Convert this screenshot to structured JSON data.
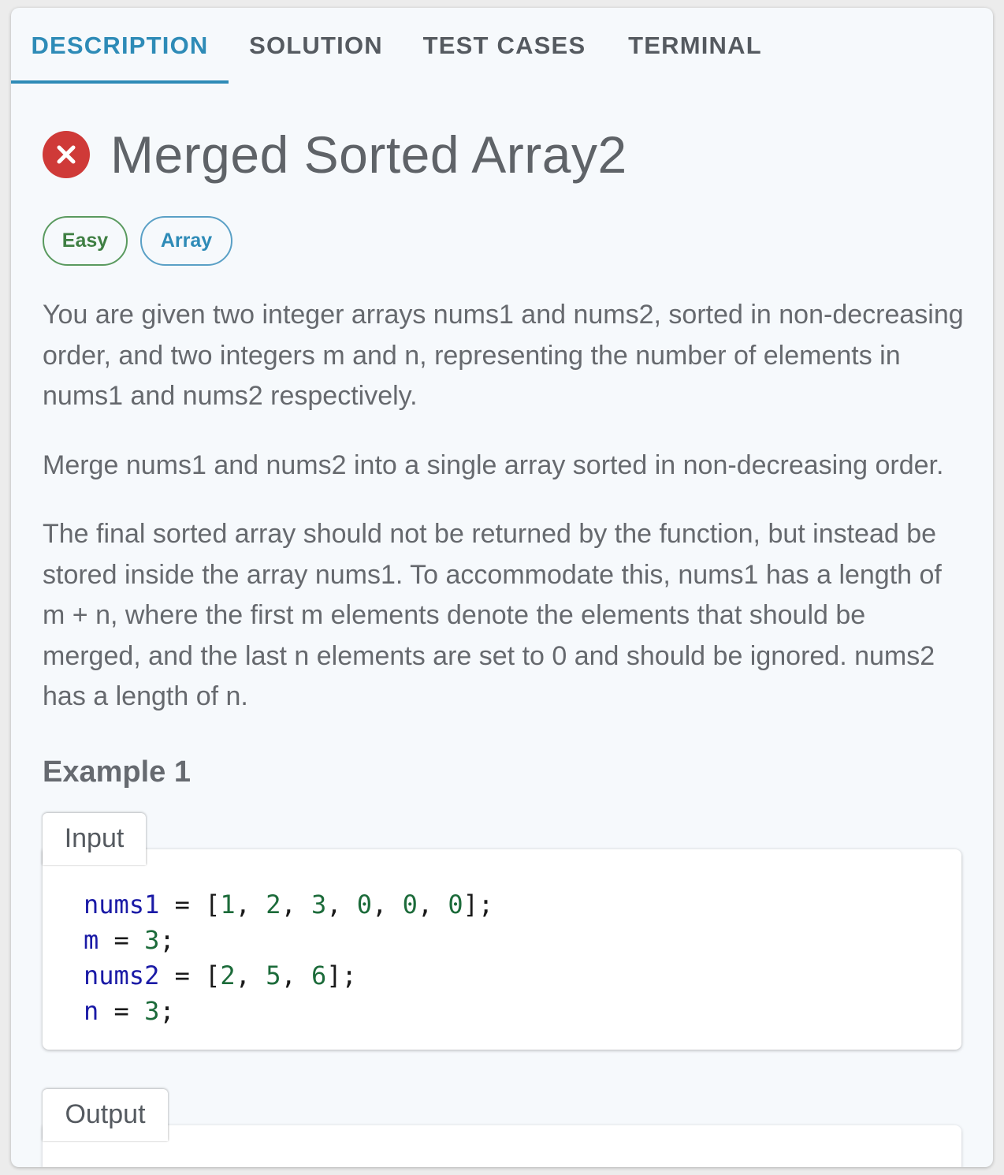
{
  "tabs": [
    {
      "label": "DESCRIPTION",
      "active": true
    },
    {
      "label": "SOLUTION"
    },
    {
      "label": "TEST CASES"
    },
    {
      "label": "TERMINAL"
    }
  ],
  "problem": {
    "status_icon": "error-x-circle-icon",
    "status_color": "#cf3a38",
    "title": "Merged Sorted Array2",
    "difficulty": "Easy",
    "tag": "Array",
    "paragraphs": [
      "You are given two integer arrays nums1 and nums2, sorted in non-decreasing order, and two integers m and n, representing the number of elements in nums1 and nums2 respectively.",
      "Merge nums1 and nums2 into a single array sorted in non-decreasing order.",
      "The final sorted array should not be returned by the function, but instead be stored inside the array nums1. To accommodate this, nums1 has a length of m + n, where the first m elements denote the elements that should be merged, and the last n elements are set to 0 and should be ignored. nums2 has a length of n."
    ]
  },
  "example": {
    "heading": "Example 1",
    "input_label": "Input",
    "input_lines": [
      {
        "var": "nums1",
        "op": " = [",
        "vals": [
          "1",
          "2",
          "3",
          "0",
          "0",
          "0"
        ],
        "end": "];"
      },
      {
        "var": "m",
        "op": " = ",
        "vals": [
          "3"
        ],
        "end": ";"
      },
      {
        "var": "nums2",
        "op": " = [",
        "vals": [
          "2",
          "5",
          "6"
        ],
        "end": "];"
      },
      {
        "var": "n",
        "op": " = ",
        "vals": [
          "3"
        ],
        "end": ";"
      }
    ],
    "output_label": "Output"
  },
  "colors": {
    "accent": "#2e8bb7",
    "easy": "#3f7f43",
    "code_var": "#1a1aa6",
    "code_num": "#1c6b3a"
  }
}
